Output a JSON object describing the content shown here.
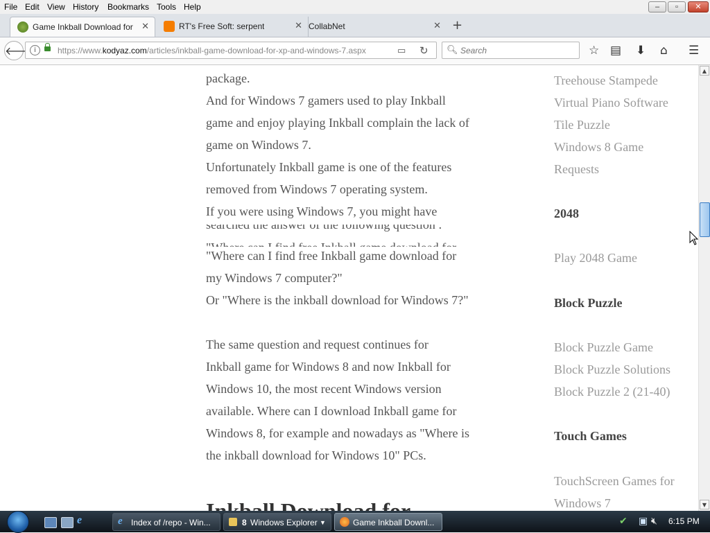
{
  "menu": [
    "File",
    "Edit",
    "View",
    "History",
    "Bookmarks",
    "Tools",
    "Help"
  ],
  "tabs": [
    {
      "title": "Game Inkball Download for",
      "active": true
    },
    {
      "title": "RT's Free Soft: serpent",
      "active": false
    },
    {
      "title": "CollabNet",
      "active": false
    }
  ],
  "nav": {
    "url_prefix": "https://www.",
    "url_domain": "kodyaz.com",
    "url_path": "/articles/inkball-game-download-for-xp-and-windows-7.aspx",
    "search_placeholder": "Search"
  },
  "article": {
    "lines": [
      "package.",
      "And for Windows 7 gamers used to play Inkball",
      "game and enjoy playing Inkball complain the lack of",
      "game on Windows 7.",
      "Unfortunately Inkball game is one of the features",
      "removed from Windows 7 operating system.",
      "If you were using Windows 7, you might have",
      "searched the answer of the following question :",
      "\"Where can I find free Inkball game download for",
      "\"Where can I find free Inkball game download for",
      "my Windows 7 computer?\"",
      "Or \"Where is the inkball download for Windows 7?\"",
      "The same question and request continues for",
      "Inkball game for Windows 8 and now Inkball for",
      "Windows 10, the most recent Windows version",
      "available. Where can I download Inkball game for",
      "Windows 8, for example and nowadays as \"Where is",
      "the inkball download for Windows 10\" PCs."
    ],
    "heading": "Inkball Download for"
  },
  "sidebar": {
    "links_top": [
      "Treehouse Stampede",
      "Virtual Piano Software",
      "Tile Puzzle",
      "Windows 8 Game",
      "Requests"
    ],
    "sections": [
      {
        "title": "2048",
        "links": [
          "Play 2048 Game"
        ]
      },
      {
        "title": "Block Puzzle",
        "links": [
          "Block Puzzle Game",
          "Block Puzzle Solutions",
          "Block Puzzle 2 (21-40)"
        ]
      },
      {
        "title": "Touch Games",
        "links": [
          "TouchScreen Games for",
          "Windows 7"
        ]
      }
    ]
  },
  "taskbar": {
    "buttons": [
      {
        "label": "Index of /repo - Win...",
        "count": ""
      },
      {
        "label": "Windows Explorer",
        "count": "8"
      },
      {
        "label": "Game Inkball Downl...",
        "count": ""
      }
    ],
    "clock": "6:15 PM"
  }
}
